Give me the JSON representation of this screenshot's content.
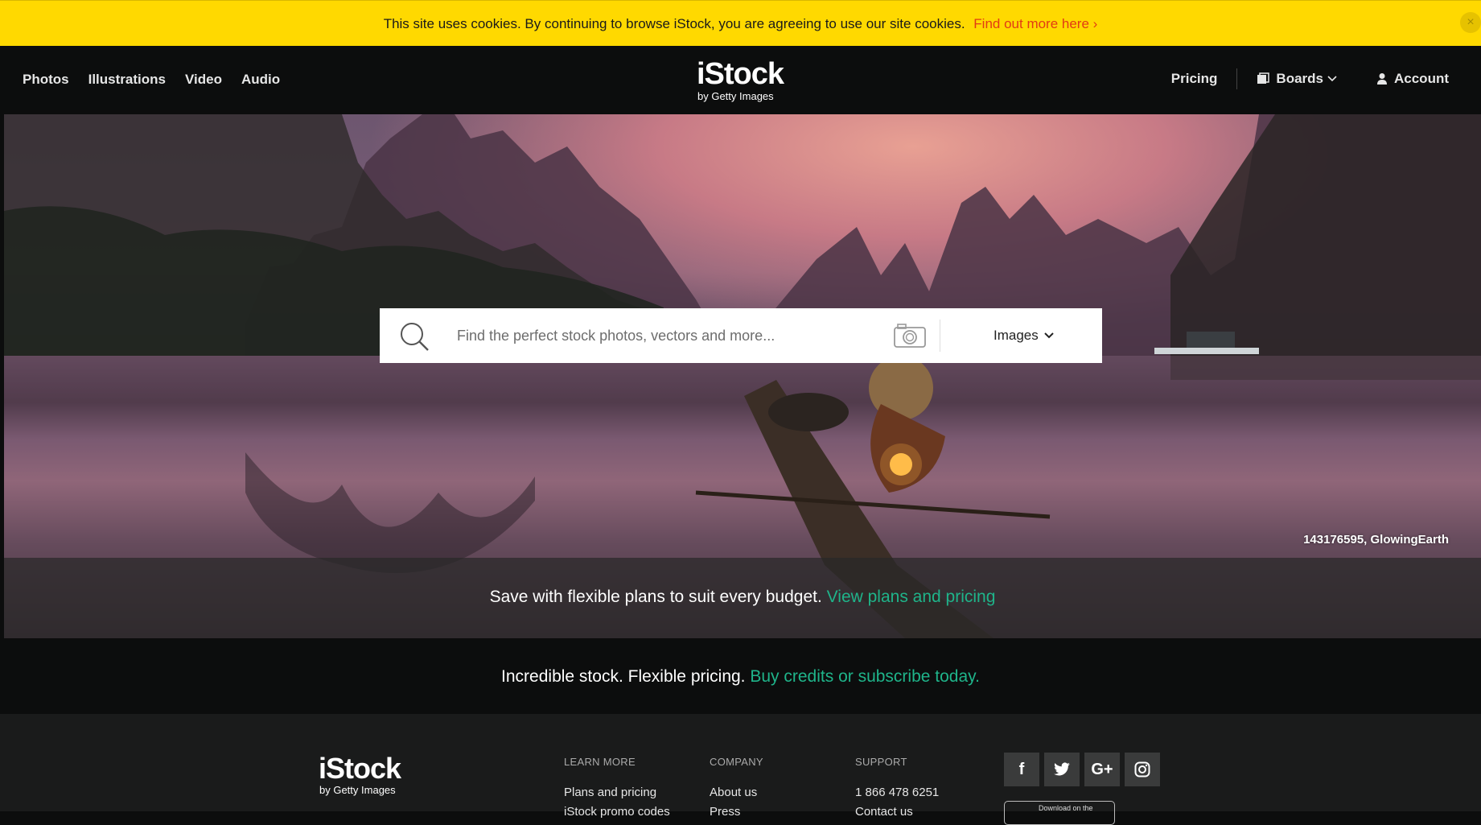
{
  "cookie": {
    "text": "This site uses cookies. By continuing to browse iStock, you are agreeing to use our site cookies.",
    "link": "Find out more here ›",
    "close": "×"
  },
  "header": {
    "nav": [
      "Photos",
      "Illustrations",
      "Video",
      "Audio"
    ],
    "logo_main": "iStock",
    "logo_sub": "by Getty Images",
    "pricing": "Pricing",
    "boards": "Boards",
    "account": "Account"
  },
  "search": {
    "placeholder": "Find the perfect stock photos, vectors and more...",
    "type": "Images"
  },
  "hero": {
    "caption": "143176595, GlowingEarth",
    "promo_text": "Save with flexible plans to suit every budget.",
    "promo_link": "View plans and pricing"
  },
  "tagline": {
    "text": "Incredible stock. Flexible pricing.",
    "link": "Buy credits or subscribe today."
  },
  "footer": {
    "logo_main": "iStock",
    "logo_sub": "by Getty Images",
    "columns": [
      {
        "heading": "LEARN MORE",
        "links": [
          "Plans and pricing",
          "iStock promo codes"
        ]
      },
      {
        "heading": "COMPANY",
        "links": [
          "About us",
          "Press"
        ]
      },
      {
        "heading": "SUPPORT",
        "links": [
          "1 866 478 6251",
          "Contact us"
        ]
      }
    ],
    "social": [
      "f",
      "twitter-icon",
      "G+",
      "instagram-icon"
    ],
    "appstore": "Download on the"
  },
  "colors": {
    "cookie_bg": "#ffd900",
    "cookie_link": "#e23b14",
    "accent_green": "#1fb48a",
    "header_bg": "#0c0d0d"
  }
}
